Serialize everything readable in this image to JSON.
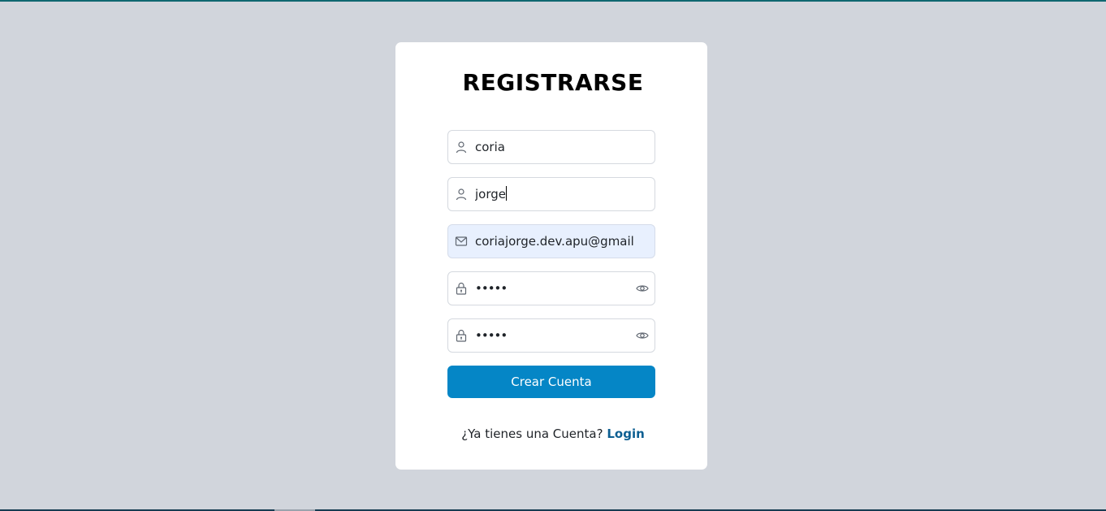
{
  "page": {
    "title": "REGISTRARSE"
  },
  "form": {
    "apellido": {
      "value": "coria",
      "icon": "user-icon"
    },
    "nombre": {
      "value": "jorge",
      "icon": "user-icon"
    },
    "email": {
      "value": "coriajorge.dev.apu@gmail",
      "icon": "mail-icon"
    },
    "password": {
      "value": "•••••",
      "icon": "lock-icon",
      "toggle_icon": "eye-icon"
    },
    "password_confirm": {
      "value": "•••••",
      "icon": "lock-icon",
      "toggle_icon": "eye-icon"
    },
    "submit_label": "Crear Cuenta"
  },
  "footer": {
    "question": "¿Ya tienes una Cuenta?",
    "login_label": "Login"
  },
  "colors": {
    "background": "#d1d5dc",
    "card": "#ffffff",
    "button": "#0586c6",
    "link": "#0d5f92",
    "autofill": "#e8f0fe"
  }
}
